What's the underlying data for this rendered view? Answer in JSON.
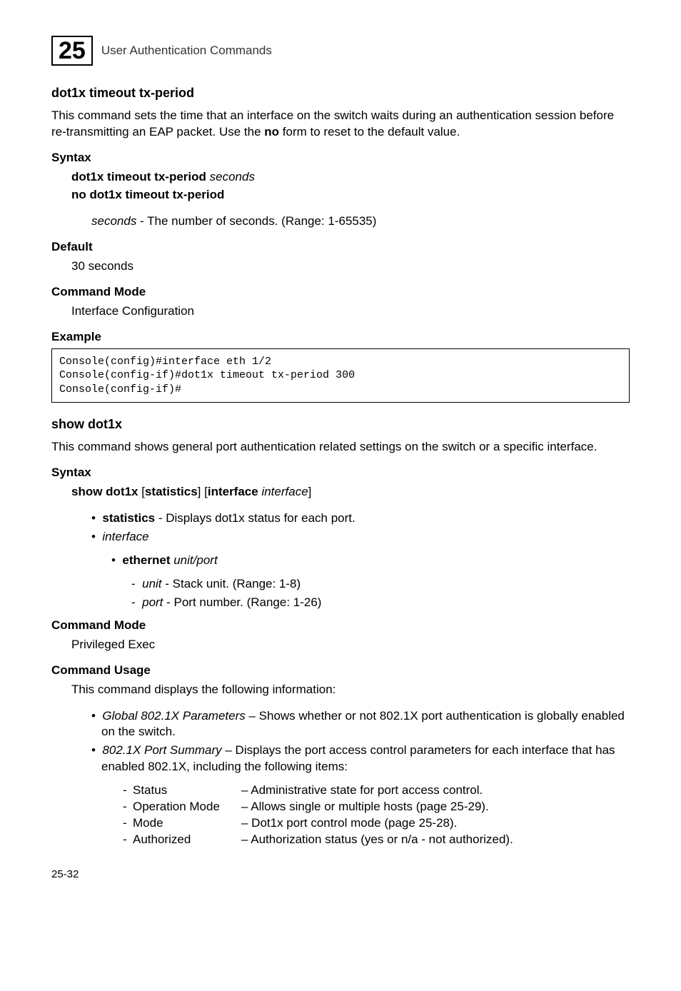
{
  "chapter": {
    "num": "25",
    "title": "User Authentication Commands"
  },
  "sec1": {
    "heading": "dot1x timeout tx-period",
    "desc_pre": "This command sets the time that an interface on the switch waits during an authentication session before re-transmitting an EAP packet. Use the ",
    "desc_bold": "no",
    "desc_post": " form to reset to the default value.",
    "syntax_h": "Syntax",
    "syntax_l1_pre": "dot1x timeout tx-period ",
    "syntax_l1_it": "seconds",
    "syntax_l2": "no dot1x timeout tx-period",
    "syntax_param_it": "seconds",
    "syntax_param_rest": " - The number of seconds. (Range: 1-65535)",
    "default_h": "Default",
    "default_v": "30 seconds",
    "mode_h": "Command Mode",
    "mode_v": "Interface Configuration",
    "example_h": "Example",
    "code": "Console(config)#interface eth 1/2\nConsole(config-if)#dot1x timeout tx-period 300\nConsole(config-if)#"
  },
  "sec2": {
    "heading": "show dot1x",
    "desc": "This command shows general port authentication related settings on the switch or a specific interface.",
    "syntax_h": "Syntax",
    "syn_b1": "show dot1x",
    "syn_br1": " [",
    "syn_b2": "statistics",
    "syn_br2": "] [",
    "syn_b3": "interface",
    "syn_sp": " ",
    "syn_it": "interface",
    "syn_br3": "]",
    "bul1_b": "statistics",
    "bul1_rest": " - Displays dot1x status for each port.",
    "bul2_it": "interface",
    "bul3_b": "ethernet",
    "bul3_sp": " ",
    "bul3_it1": "unit",
    "bul3_sep": "/",
    "bul3_it2": "port",
    "bul4_it": "unit",
    "bul4_rest": " - Stack unit. (Range: 1-8)",
    "bul5_it": "port",
    "bul5_rest": " - Port number. (Range: 1-26)",
    "mode_h": "Command Mode",
    "mode_v": "Privileged Exec",
    "usage_h": "Command Usage",
    "usage_intro": "This command displays the following information:",
    "u1_it": "Global 802.1X Parameters",
    "u1_rest": " – Shows whether or not 802.1X port authentication is globally enabled on the switch.",
    "u2_it": "802.1X Port Summary",
    "u2_rest": " – Displays the port access control parameters for each interface that has enabled 802.1X, including the following items:",
    "d1_l": "Status",
    "d1_r": "– Administrative state for port access control.",
    "d2_l": "Operation Mode",
    "d2_r": "– Allows single or multiple hosts (page 25-29).",
    "d3_l": "Mode",
    "d3_r": "– Dot1x port control mode (page 25-28).",
    "d4_l": "Authorized",
    "d4_r": "– Authorization status (yes or n/a - not authorized)."
  },
  "footer": "25-32"
}
